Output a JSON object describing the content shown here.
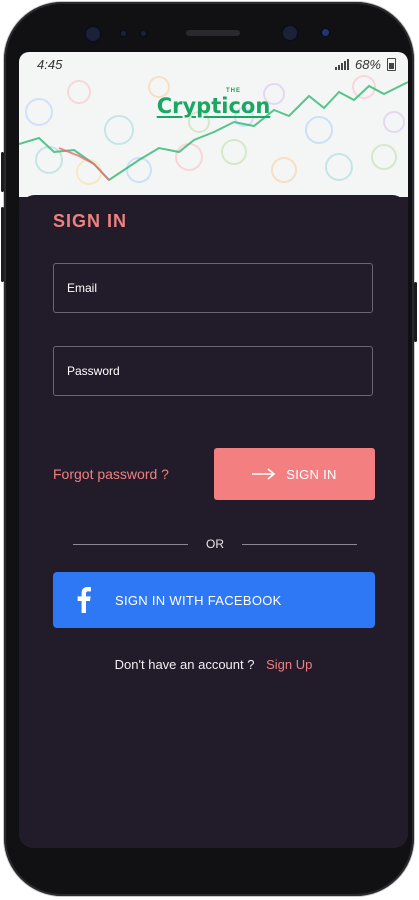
{
  "status_bar": {
    "time": "4:45",
    "battery": "68%"
  },
  "brand": {
    "prefix": "THE",
    "name": "Crypticon"
  },
  "signin_form": {
    "title": "SIGN IN",
    "email_placeholder": "Email",
    "password_placeholder": "Password",
    "forgot_password": "Forgot password ?",
    "submit_label": "SIGN IN",
    "divider_label": "OR",
    "facebook_label": "SIGN IN WITH FACEBOOK",
    "no_account_text": "Don't have an account ?",
    "signup_link": "Sign Up"
  },
  "colors": {
    "accent": "#f37f81",
    "facebook": "#2f78f5",
    "card_bg": "#221b2a",
    "brand_green": "#1aa763"
  },
  "icons": {
    "submit_icon": "arrow-right-icon",
    "facebook_icon": "facebook-f-icon"
  }
}
